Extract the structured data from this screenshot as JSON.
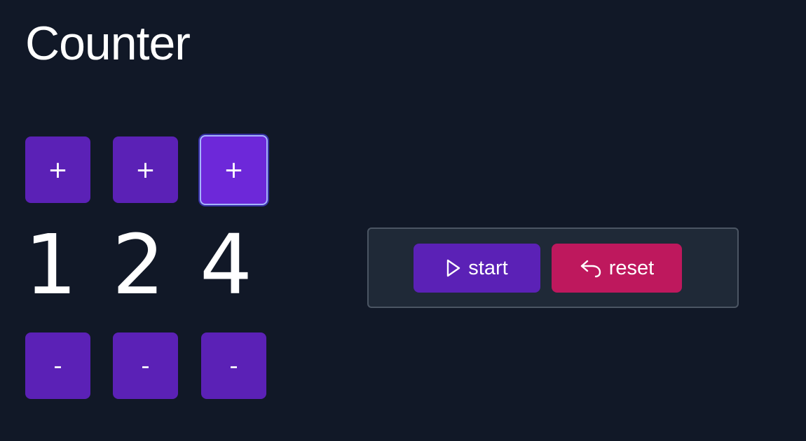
{
  "page": {
    "title": "Counter"
  },
  "counters": [
    {
      "increment_label": "+",
      "value": "1",
      "decrement_label": "-"
    },
    {
      "increment_label": "+",
      "value": "2",
      "decrement_label": "-"
    },
    {
      "increment_label": "+",
      "value": "4",
      "decrement_label": "-"
    }
  ],
  "controls": {
    "start_label": "start",
    "start_icon": "play-icon",
    "reset_label": "reset",
    "reset_icon": "undo-arrow-icon"
  },
  "colors": {
    "background": "#111827",
    "button_purple": "#5b21b6",
    "button_purple_focused": "#6d28d9",
    "reset_pink": "#be185d",
    "panel_bg": "#1f2937",
    "panel_border": "#4b5563"
  }
}
